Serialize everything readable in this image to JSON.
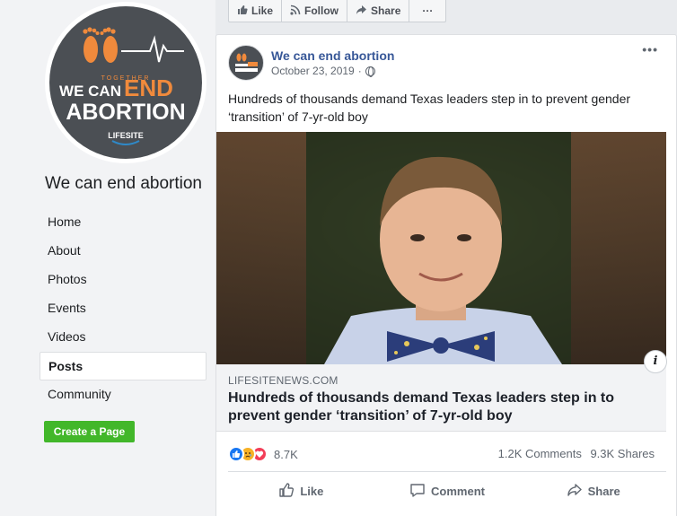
{
  "page": {
    "name": "We can end abortion",
    "avatar_text": {
      "line1": "TOGETHER",
      "line2_a": "WE CAN",
      "line2_b": "END",
      "line3": "ABORTION",
      "brand": "LIFESITE"
    }
  },
  "sidebar": {
    "items": [
      {
        "label": "Home"
      },
      {
        "label": "About"
      },
      {
        "label": "Photos"
      },
      {
        "label": "Events"
      },
      {
        "label": "Videos"
      },
      {
        "label": "Posts",
        "active": true
      },
      {
        "label": "Community"
      }
    ],
    "create_page_label": "Create a Page"
  },
  "action_bar": {
    "like_label": "Like",
    "follow_label": "Follow",
    "share_label": "Share",
    "more_label": "···"
  },
  "post": {
    "author": "We can end abortion",
    "date": "October 23, 2019",
    "separator": "·",
    "more_label": "•••",
    "text": "Hundreds of thousands demand Texas leaders step in to prevent gender ‘transition’ of 7-yr-old boy",
    "link": {
      "domain": "LIFESITENEWS.COM",
      "title": "Hundreds of thousands demand Texas leaders step in to prevent gender ‘transition’ of 7-yr-old boy",
      "info_label": "i"
    },
    "reactions_count": "8.7K",
    "comments": "1.2K Comments",
    "shares": "9.3K Shares",
    "actions": {
      "like": "Like",
      "comment": "Comment",
      "share": "Share"
    }
  },
  "colors": {
    "accent_orange": "#f08a3c",
    "link_blue": "#385898",
    "create_green": "#42b72a"
  }
}
